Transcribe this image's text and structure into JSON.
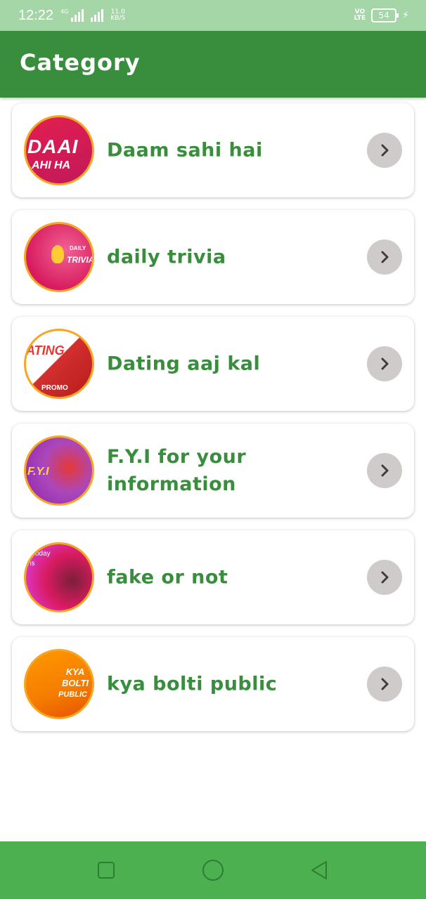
{
  "status_bar": {
    "time": "12:22",
    "network_tag": "4G",
    "speed_value": "11.0",
    "speed_unit": "KB/S",
    "volte_line1": "VO",
    "volte_line2": "LTE",
    "battery_level": "54",
    "icons": [
      "signal-icon",
      "signal-icon",
      "battery-icon",
      "charging-icon"
    ]
  },
  "app_bar": {
    "title": "Category"
  },
  "categories": [
    {
      "label": "Daam sahi hai",
      "thumb_line1": "DAAI",
      "thumb_line2": "AHI HA"
    },
    {
      "label": "daily trivia",
      "thumb_line1": "DAILY",
      "thumb_line2": "TRIVIA"
    },
    {
      "label": "Dating aaj kal",
      "thumb_line1": "ATING",
      "thumb_line2": "PROMO"
    },
    {
      "label": "F.Y.I for your information",
      "thumb_line1": "F.Y.I"
    },
    {
      "label": "fake or not",
      "thumb_line1": "Today",
      "thumb_line2": "ns"
    },
    {
      "label": "kya bolti public",
      "thumb_line1": "KYA BOLTI",
      "thumb_line2": "PUBLIC"
    }
  ],
  "colors": {
    "status_bar": "#a5d6a7",
    "app_bar": "#388e3c",
    "accent_text": "#388e3c",
    "nav_bar": "#4caf50",
    "chevron_bg": "#cfcbcb",
    "thumb_border": "#f5a623"
  },
  "nav_bar": {
    "icons": [
      "recent-apps-icon",
      "home-icon",
      "back-icon"
    ]
  }
}
